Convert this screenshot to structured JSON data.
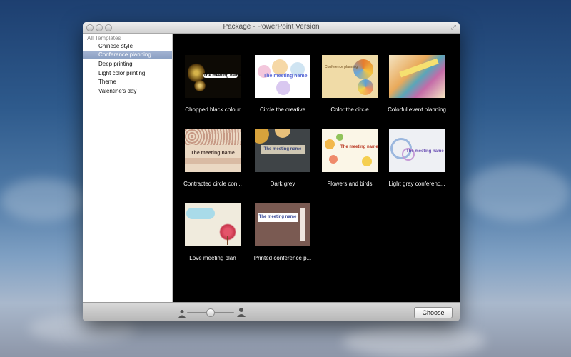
{
  "window": {
    "title": "Package - PowerPoint Version"
  },
  "sidebar": {
    "header": "All Templates",
    "items": [
      {
        "label": "Chinese style",
        "selected": false
      },
      {
        "label": "Conference planning",
        "selected": true
      },
      {
        "label": "Deep printing",
        "selected": false
      },
      {
        "label": "Light color printing",
        "selected": false
      },
      {
        "label": "Theme",
        "selected": false
      },
      {
        "label": "Valentine's day",
        "selected": false
      }
    ]
  },
  "templates": [
    {
      "label": "Chopped black colour",
      "thumb_text": "The meeting name"
    },
    {
      "label": "Circle the creative",
      "thumb_text": "The meeting name"
    },
    {
      "label": "Color the circle",
      "thumb_text": "Conference planning"
    },
    {
      "label": "Colorful event planning",
      "thumb_text": ""
    },
    {
      "label": "Contracted circle con...",
      "thumb_text": "The meeting name"
    },
    {
      "label": "Dark grey",
      "thumb_text": "The meeting name"
    },
    {
      "label": "Flowers and birds",
      "thumb_text": "The meeting name"
    },
    {
      "label": "Light gray conferenc...",
      "thumb_text": "The meeting name"
    },
    {
      "label": "Love meeting plan",
      "thumb_text": ""
    },
    {
      "label": "Printed conference p...",
      "thumb_text": "The meeting name"
    }
  ],
  "footer": {
    "choose_label": "Choose",
    "zoom_level": 0.45,
    "small_icon": "person-small-icon",
    "large_icon": "person-large-icon"
  },
  "colors": {
    "selection": "#8a9fc2",
    "gallery_bg": "#000000",
    "sidebar_bg": "#ffffff"
  }
}
